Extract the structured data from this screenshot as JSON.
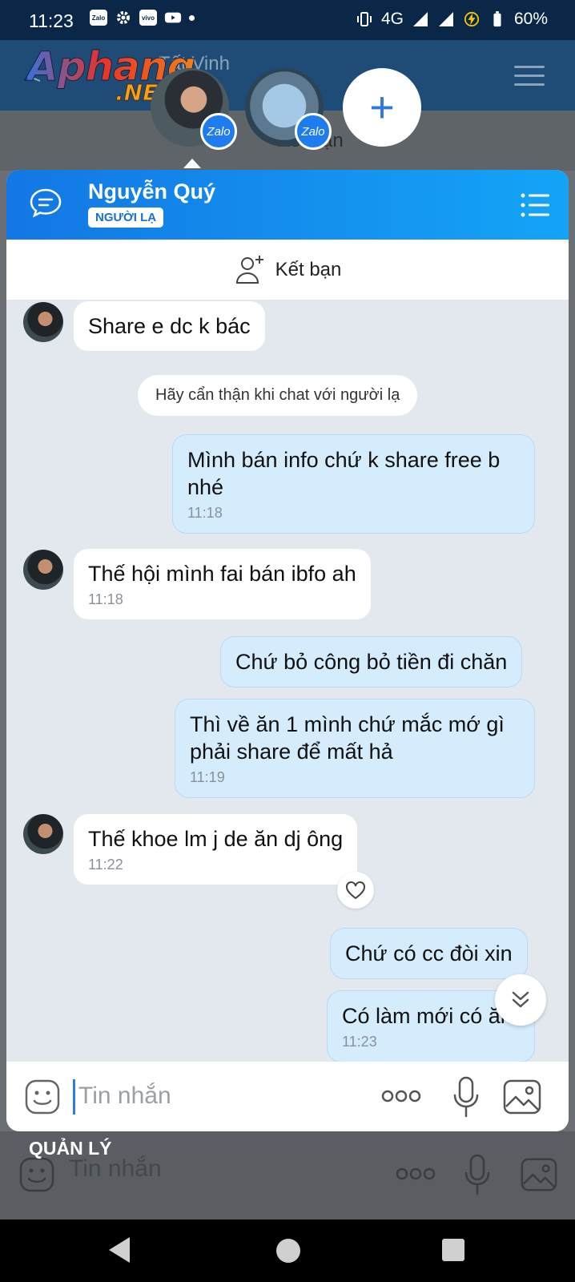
{
  "status_bar": {
    "time": "11:23",
    "app_icons": [
      "Zalo",
      "settings",
      "vivo",
      "youtube"
    ],
    "network": "4G",
    "battery": "60%"
  },
  "background_screen": {
    "title": "Tất Vinh",
    "tag": "NGƯỜI LẠ",
    "add_friend": "Kết bạn",
    "manage_label": "QUẢN LÝ",
    "input_placeholder": "Tin nhắn"
  },
  "watermark": {
    "main": "Aphang",
    "suffix": ".NET"
  },
  "chat_heads": {
    "badge_label": "Zalo",
    "add_symbol": "+"
  },
  "popup": {
    "contact_name": "Nguyễn Quý",
    "contact_tag": "NGƯỜI LẠ",
    "add_friend_label": "Kết bạn",
    "header_color": "#1377e4",
    "system_notice": "Hãy cẩn thận khi chat với người lạ",
    "messages": [
      {
        "dir": "in",
        "text": "Share e dc k bác",
        "time": ""
      },
      {
        "dir": "out",
        "text": "Mình bán info chứ k share free b nhé",
        "time": "11:18"
      },
      {
        "dir": "in",
        "text": "Thế hội mình fai bán ibfo ah",
        "time": "11:18"
      },
      {
        "dir": "out",
        "text": "Chứ bỏ công bỏ tiền đi chăn",
        "time": ""
      },
      {
        "dir": "out",
        "text": "Thì về ăn 1 mình chứ mắc mớ gì phải share để mất hả",
        "time": "11:19"
      },
      {
        "dir": "in",
        "text": "Thế khoe lm j de ăn dj ông",
        "time": "11:22"
      },
      {
        "dir": "out",
        "text": "Chứ có cc đòi xin",
        "time": ""
      },
      {
        "dir": "out",
        "text": "Có làm mới có ăn",
        "time": "11:23"
      }
    ],
    "input_placeholder": "Tin nhắn",
    "icons": {
      "emoji": "emoji-icon",
      "more": "more-dots-icon",
      "mic": "microphone-icon",
      "gallery": "image-gallery-icon",
      "reaction": "heart-icon",
      "scroll": "chevron-double-down-icon"
    }
  }
}
